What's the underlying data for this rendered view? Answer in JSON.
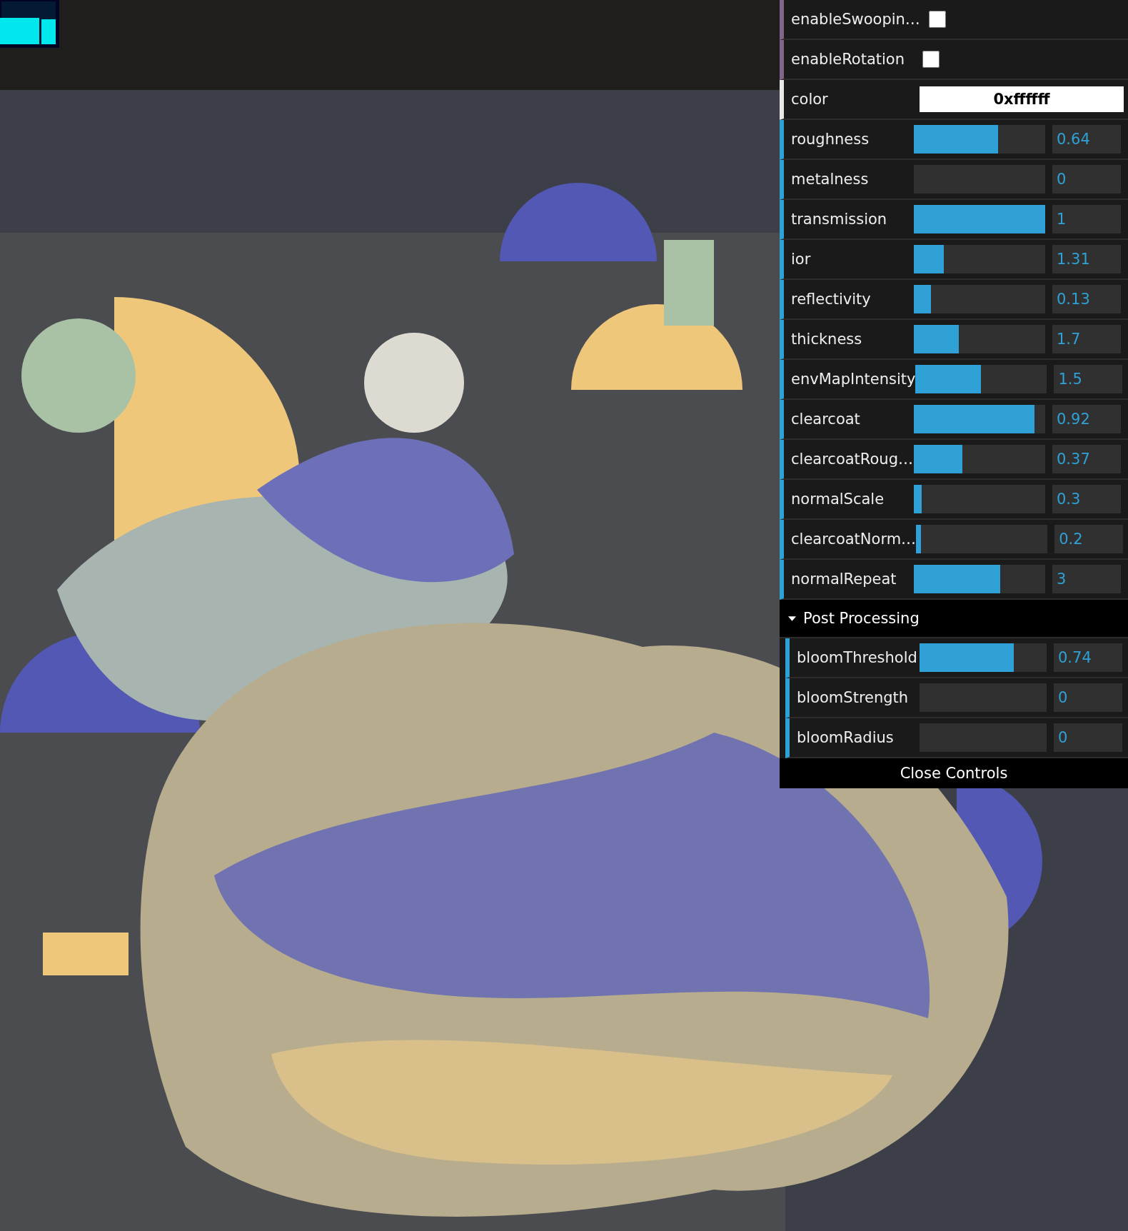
{
  "controls": [
    {
      "kind": "boolean",
      "label": "enableSwoopin…",
      "checked": false
    },
    {
      "kind": "boolean",
      "label": "enableRotation",
      "checked": false
    },
    {
      "kind": "color",
      "label": "color",
      "value": "0xffffff"
    },
    {
      "kind": "number",
      "label": "roughness",
      "level": 0.64,
      "value": "0.64"
    },
    {
      "kind": "number",
      "label": "metalness",
      "level": 0,
      "value": "0"
    },
    {
      "kind": "number",
      "label": "transmission",
      "level": 1,
      "value": "1"
    },
    {
      "kind": "number",
      "label": "ior",
      "level": 0.23,
      "value": "1.31"
    },
    {
      "kind": "number",
      "label": "reflectivity",
      "level": 0.13,
      "value": "0.13"
    },
    {
      "kind": "number",
      "label": "thickness",
      "level": 0.34,
      "value": "1.7"
    },
    {
      "kind": "number",
      "label": "envMapIntensity",
      "level": 0.5,
      "value": "1.5"
    },
    {
      "kind": "number",
      "label": "clearcoat",
      "level": 0.92,
      "value": "0.92"
    },
    {
      "kind": "number",
      "label": "clearcoatRoug…",
      "level": 0.37,
      "value": "0.37"
    },
    {
      "kind": "number",
      "label": "normalScale",
      "level": 0.06,
      "value": "0.3"
    },
    {
      "kind": "number",
      "label": "clearcoatNorm…",
      "level": 0.04,
      "value": "0.2"
    },
    {
      "kind": "number",
      "label": "normalRepeat",
      "level": 0.66,
      "value": "3"
    }
  ],
  "post_processing": {
    "title": "Post Processing",
    "expanded": true,
    "controls": [
      {
        "kind": "number",
        "label": "bloomThreshold",
        "level": 0.74,
        "value": "0.74"
      },
      {
        "kind": "number",
        "label": "bloomStrength",
        "level": 0,
        "value": "0"
      },
      {
        "kind": "number",
        "label": "bloomRadius",
        "level": 0,
        "value": "0"
      }
    ]
  },
  "close_button": "Close Controls"
}
